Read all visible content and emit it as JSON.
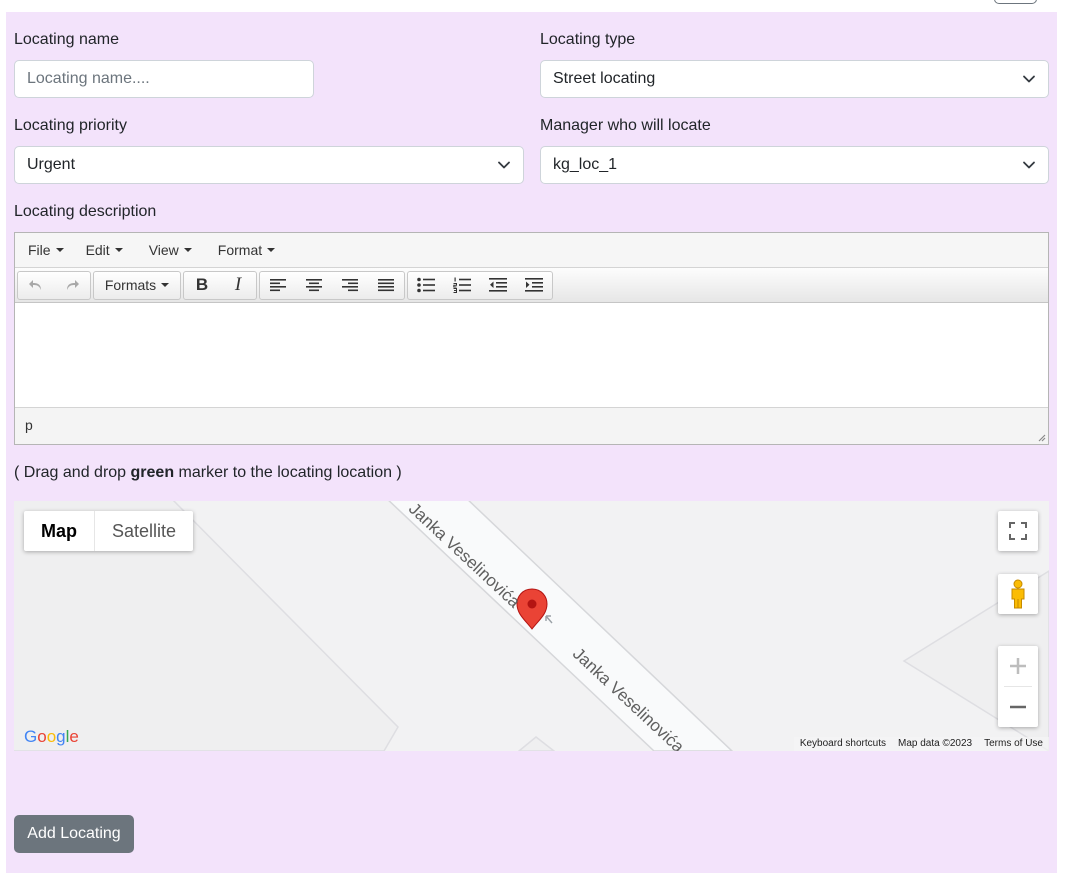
{
  "form": {
    "name_label": "Locating name",
    "name_placeholder": "Locating name....",
    "type_label": "Locating type",
    "type_value": "Street locating",
    "priority_label": "Locating priority",
    "priority_value": "Urgent",
    "manager_label": "Manager who will locate",
    "manager_value": "kg_loc_1",
    "description_label": "Locating description"
  },
  "editor": {
    "menu": [
      "File",
      "Edit",
      "View",
      "Format"
    ],
    "formats_label": "Formats",
    "bold_label": "B",
    "italic_label": "I",
    "status_path": "p"
  },
  "instruction": {
    "before": "( Drag and drop ",
    "bold": "green",
    "after": " marker to the locating location )"
  },
  "map": {
    "type_map": "Map",
    "type_satellite": "Satellite",
    "street_label_1": "Janka Veselinovića",
    "street_label_2": "Janka Veselinovića",
    "logo": "Google",
    "attribution": [
      "Keyboard shortcuts",
      "Map data ©2023",
      "Terms of Use"
    ],
    "icons": [
      "fullscreen-icon",
      "pegman-icon",
      "zoom-in-icon",
      "zoom-out-icon",
      "map-marker-icon"
    ]
  },
  "actions": {
    "submit_label": "Add Locating"
  },
  "colors": {
    "panel_bg": "#f3e3fb",
    "button_bg": "#6c757d",
    "marker": "#ea4335"
  }
}
